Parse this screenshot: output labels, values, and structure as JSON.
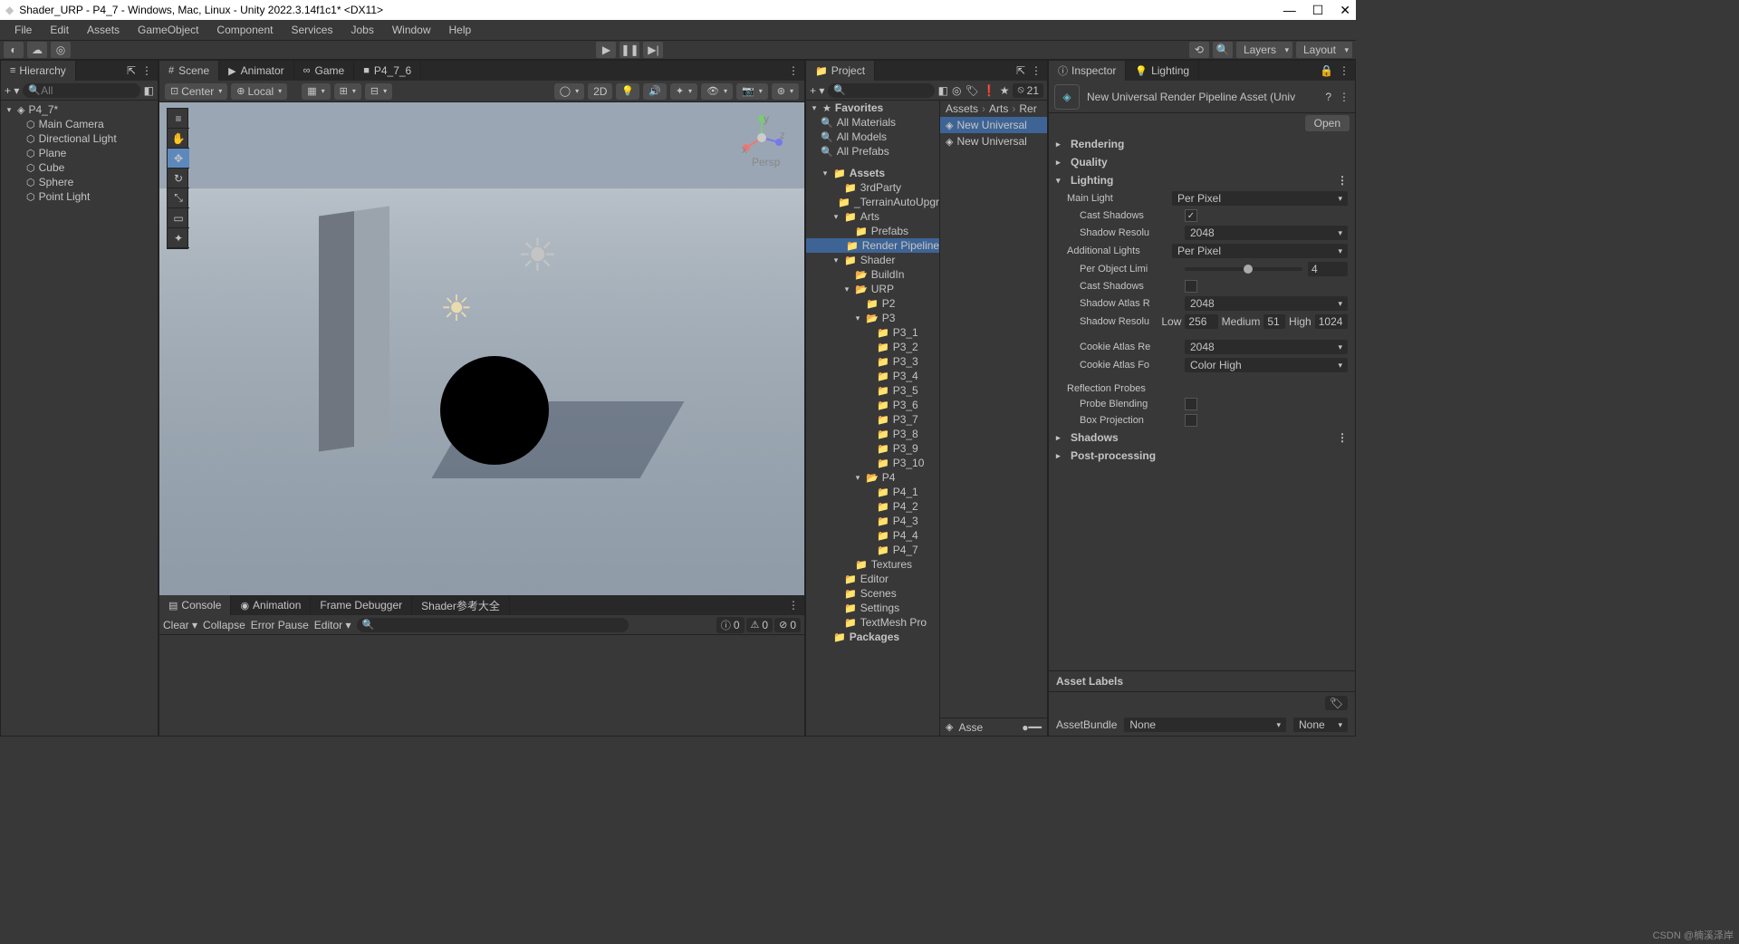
{
  "window": {
    "title": "Shader_URP - P4_7 - Windows, Mac, Linux - Unity 2022.3.14f1c1* <DX11>"
  },
  "menus": [
    "File",
    "Edit",
    "Assets",
    "GameObject",
    "Component",
    "Services",
    "Jobs",
    "Window",
    "Help"
  ],
  "layout_dd": {
    "layers": "Layers",
    "layout": "Layout"
  },
  "hierarchy": {
    "tab": "Hierarchy",
    "search_ph": "All",
    "root": "P4_7*",
    "items": [
      "Main Camera",
      "Directional Light",
      "Plane",
      "Cube",
      "Sphere",
      "Point Light"
    ]
  },
  "scene_tabs": [
    {
      "label": "Scene",
      "icon": "#"
    },
    {
      "label": "Animator",
      "icon": "▶"
    },
    {
      "label": "Game",
      "icon": "∞"
    },
    {
      "label": "P4_7_6",
      "icon": "■"
    }
  ],
  "scene_toolbar": {
    "pivot": "Center",
    "space": "Local",
    "mode2d": "2D",
    "persp": "Persp",
    "axis": {
      "x": "x",
      "y": "y",
      "z": "z"
    }
  },
  "bottom_tabs": [
    "Console",
    "Animation",
    "Frame Debugger",
    "Shader参考大全"
  ],
  "console_bar": {
    "clear": "Clear",
    "collapse": "Collapse",
    "error_pause": "Error Pause",
    "editor": "Editor",
    "counts": {
      "info": "0",
      "warn": "0",
      "err": "0"
    }
  },
  "project": {
    "tab": "Project",
    "scene_count": "21",
    "favorites": {
      "label": "Favorites",
      "items": [
        "All Materials",
        "All Models",
        "All Prefabs"
      ]
    },
    "tree": [
      {
        "label": "Assets",
        "depth": 0,
        "exp": true,
        "icon": "📁"
      },
      {
        "label": "3rdParty",
        "depth": 1,
        "icon": "📁"
      },
      {
        "label": "_TerrainAutoUpgr",
        "depth": 1,
        "icon": "📁"
      },
      {
        "label": "Arts",
        "depth": 1,
        "exp": true,
        "icon": "📁"
      },
      {
        "label": "Prefabs",
        "depth": 2,
        "icon": "📁"
      },
      {
        "label": "Render Pipeline",
        "depth": 2,
        "icon": "📁",
        "sel": true
      },
      {
        "label": "Shader",
        "depth": 1,
        "exp": true,
        "icon": "📁"
      },
      {
        "label": "BuildIn",
        "depth": 2,
        "icon": "📂"
      },
      {
        "label": "URP",
        "depth": 2,
        "exp": true,
        "icon": "📂"
      },
      {
        "label": "P2",
        "depth": 3,
        "icon": "📁"
      },
      {
        "label": "P3",
        "depth": 3,
        "exp": true,
        "icon": "📂"
      },
      {
        "label": "P3_1",
        "depth": 4,
        "icon": "📁"
      },
      {
        "label": "P3_2",
        "depth": 4,
        "icon": "📁"
      },
      {
        "label": "P3_3",
        "depth": 4,
        "icon": "📁"
      },
      {
        "label": "P3_4",
        "depth": 4,
        "icon": "📁"
      },
      {
        "label": "P3_5",
        "depth": 4,
        "icon": "📁"
      },
      {
        "label": "P3_6",
        "depth": 4,
        "icon": "📁"
      },
      {
        "label": "P3_7",
        "depth": 4,
        "icon": "📁"
      },
      {
        "label": "P3_8",
        "depth": 4,
        "icon": "📁"
      },
      {
        "label": "P3_9",
        "depth": 4,
        "icon": "📁"
      },
      {
        "label": "P3_10",
        "depth": 4,
        "icon": "📁"
      },
      {
        "label": "P4",
        "depth": 3,
        "exp": true,
        "icon": "📂"
      },
      {
        "label": "P4_1",
        "depth": 4,
        "icon": "📁"
      },
      {
        "label": "P4_2",
        "depth": 4,
        "icon": "📁"
      },
      {
        "label": "P4_3",
        "depth": 4,
        "icon": "📁"
      },
      {
        "label": "P4_4",
        "depth": 4,
        "icon": "📁"
      },
      {
        "label": "P4_7",
        "depth": 4,
        "icon": "📁"
      },
      {
        "label": "Textures",
        "depth": 2,
        "icon": "📁"
      },
      {
        "label": "Editor",
        "depth": 1,
        "icon": "📁"
      },
      {
        "label": "Scenes",
        "depth": 1,
        "icon": "📁"
      },
      {
        "label": "Settings",
        "depth": 1,
        "icon": "📁"
      },
      {
        "label": "TextMesh Pro",
        "depth": 1,
        "icon": "📁"
      },
      {
        "label": "Packages",
        "depth": 0,
        "icon": "📁"
      }
    ],
    "breadcrumb": [
      "Assets",
      "Arts",
      "Rer"
    ],
    "list": [
      {
        "label": "New Universal",
        "sel": true
      },
      {
        "label": "New Universal"
      }
    ],
    "footer": "Asse"
  },
  "inspector": {
    "tabs": [
      "Inspector",
      "Lighting"
    ],
    "asset_name": "New Universal Render Pipeline Asset (Univ",
    "open": "Open",
    "sections": {
      "rendering": "Rendering",
      "quality": "Quality",
      "lighting": "Lighting",
      "shadows": "Shadows",
      "post": "Post-processing"
    },
    "lighting": {
      "main_light_lbl": "Main Light",
      "main_light": "Per Pixel",
      "cast_shadows_lbl": "Cast Shadows",
      "cast_shadows": true,
      "shadow_res_lbl": "Shadow Resolu",
      "shadow_res": "2048",
      "add_lights_lbl": "Additional Lights",
      "add_lights": "Per Pixel",
      "per_obj_lbl": "Per Object Limi",
      "per_obj": "4",
      "per_obj_pct": 50,
      "cast_shadows2_lbl": "Cast Shadows",
      "cast_shadows2": false,
      "shadow_atlas_lbl": "Shadow Atlas R",
      "shadow_atlas": "2048",
      "shadow_resolu_lbl": "Shadow Resolu",
      "low_lbl": "Low",
      "low": "256",
      "med_lbl": "Medium",
      "med": "51",
      "high_lbl": "High",
      "high": "1024",
      "cookie_atlas_lbl": "Cookie Atlas Re",
      "cookie_atlas": "2048",
      "cookie_fmt_lbl": "Cookie Atlas Fo",
      "cookie_fmt": "Color High",
      "refl_probes": "Reflection Probes",
      "probe_blend_lbl": "Probe Blending",
      "probe_blend": false,
      "box_proj_lbl": "Box Projection",
      "box_proj": false
    },
    "asset_labels": "Asset Labels",
    "assetbundle_lbl": "AssetBundle",
    "assetbundle": "None",
    "ab_variant": "None"
  },
  "watermark": "CSDN @楠溪泽岸"
}
